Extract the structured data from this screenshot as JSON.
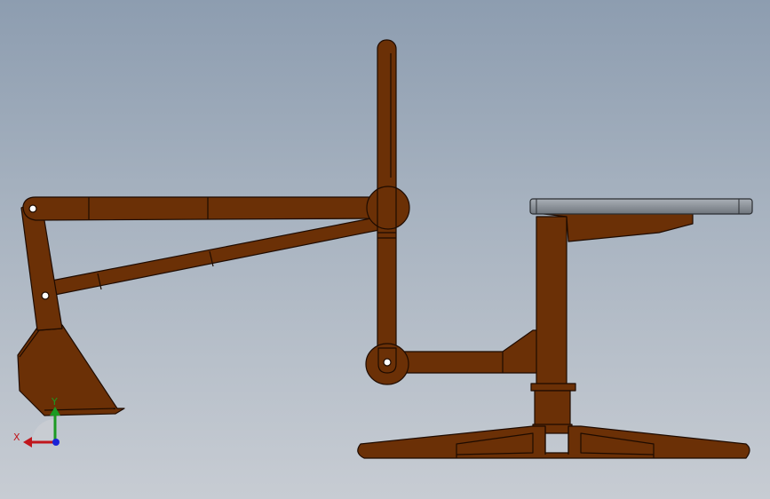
{
  "viewport": {
    "background_top": "#8d9db0",
    "background_bottom": "#c7ccd3"
  },
  "model": {
    "part_color": "#6b3006",
    "part_stroke": "#1e0b00",
    "seat_color": "#7f858d",
    "seat_stroke": "#2a2d31",
    "components": [
      "bucket",
      "boom-arm",
      "brace-arm",
      "vertical-lever",
      "pivot-hub",
      "crank-arm",
      "pedestal-column",
      "seat-plate",
      "base-feet"
    ]
  },
  "triad": {
    "x_label": "X",
    "y_label": "Y",
    "x_color": "#c0161c",
    "y_color": "#1c9a22",
    "z_color": "#1a23d8"
  }
}
